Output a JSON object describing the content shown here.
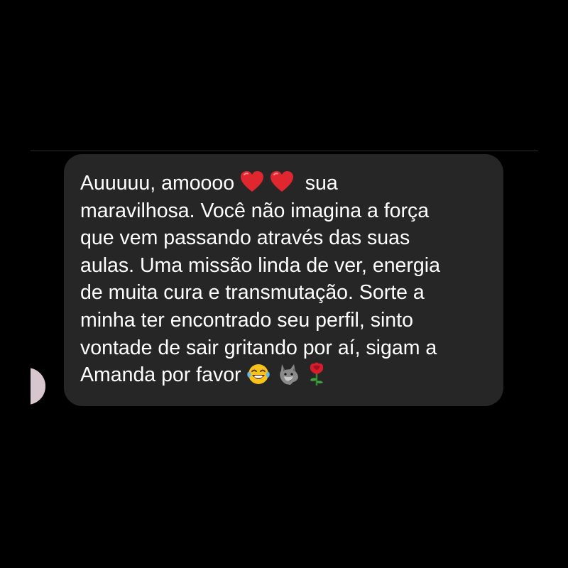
{
  "message": {
    "lines": [
      "Auuuuu, amoooo",
      "sua",
      "maravilhosa. Você não imagina a força",
      "que vem passando através das suas",
      "aulas. Uma missão linda de ver, energia",
      "de muita cura e transmutação. Sorte a",
      "minha ter encontrado seu perfil, sinto",
      "vontade de sair gritando por aí, sigam a",
      "Amanda por favor"
    ],
    "emojis": {
      "line1": [
        "red-heart-icon",
        "red-heart-icon"
      ],
      "last_line": [
        "tears-of-joy-icon",
        "wolf-icon",
        "red-rose-icon"
      ]
    }
  },
  "colors": {
    "background": "#000000",
    "bubble": "#262626",
    "text": "#ffffff",
    "heart": "#e0262f"
  }
}
